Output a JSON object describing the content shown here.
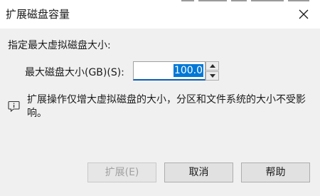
{
  "dialog": {
    "title": "扩展磁盘容量",
    "prompt": "指定最大虚拟磁盘大小:",
    "size_label": "最大磁盘大小(GB)(S):",
    "size_value": "100.0",
    "info_text": "扩展操作仅增大虚拟磁盘的大小，分区和文件系统的大小不受影响。",
    "buttons": {
      "expand": "扩展(E)",
      "cancel": "取消",
      "help": "帮助"
    },
    "icons": {
      "close": "close-icon",
      "spin_up": "triangle-up-icon",
      "spin_down": "triangle-down-icon",
      "info": "info-speech-icon"
    },
    "colors": {
      "selection": "#0078d7",
      "input_focus_border": "#0b5fb5",
      "content_bg": "#f0f0f0"
    }
  }
}
